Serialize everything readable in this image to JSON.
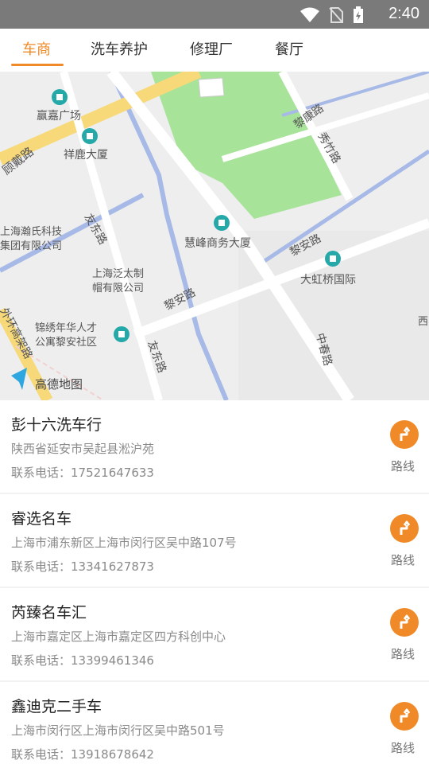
{
  "status_bar": {
    "time": "2:40"
  },
  "tabs": [
    {
      "label": "车商",
      "active": true
    },
    {
      "label": "洗车养护",
      "active": false
    },
    {
      "label": "修理厂",
      "active": false
    },
    {
      "label": "餐厅",
      "active": false
    }
  ],
  "colors": {
    "accent": "#f08a28",
    "status_bar": "#7a7a7a"
  },
  "map": {
    "labels": {
      "yingjia": "赢嘉广场",
      "xianglu": "祥鹿大厦",
      "gudai": "顾戴路",
      "lijiang": "黎康路",
      "xiuzhu": "秀竹路",
      "hanshi1": "上海瀚氏科技",
      "hanshi2": "集团有限公司",
      "youdong": "友东路",
      "huifeng": "慧峰商务大厦",
      "lian1": "黎安路",
      "fantai1": "上海泛太制",
      "fantai2": "帽有限公司",
      "dahongqiao": "大虹桥国际",
      "lian2": "黎安路",
      "gaojia": "外环高架路",
      "jinxiu1": "锦绣年华人才",
      "jinxiu2": "公寓黎安社区",
      "youdong2": "友东路",
      "zhongchun": "中春路",
      "xi": "西",
      "amap_logo": "高德地图"
    }
  },
  "dealers": [
    {
      "name": "彭十六洗车行",
      "address": "陕西省延安市吴起县淞沪苑",
      "phone": "联系电话：17521647633",
      "route_label": "路线"
    },
    {
      "name": "睿选名车",
      "address": "上海市浦东新区上海市闵行区吴中路107号",
      "phone": "联系电话：13341627873",
      "route_label": "路线"
    },
    {
      "name": "芮臻名车汇",
      "address": "上海市嘉定区上海市嘉定区四方科创中心",
      "phone": "联系电话：13399461346",
      "route_label": "路线"
    },
    {
      "name": "鑫迪克二手车",
      "address": "上海市闵行区上海市闵行区吴中路501号",
      "phone": "联系电话：13918678642",
      "route_label": "路线"
    }
  ]
}
